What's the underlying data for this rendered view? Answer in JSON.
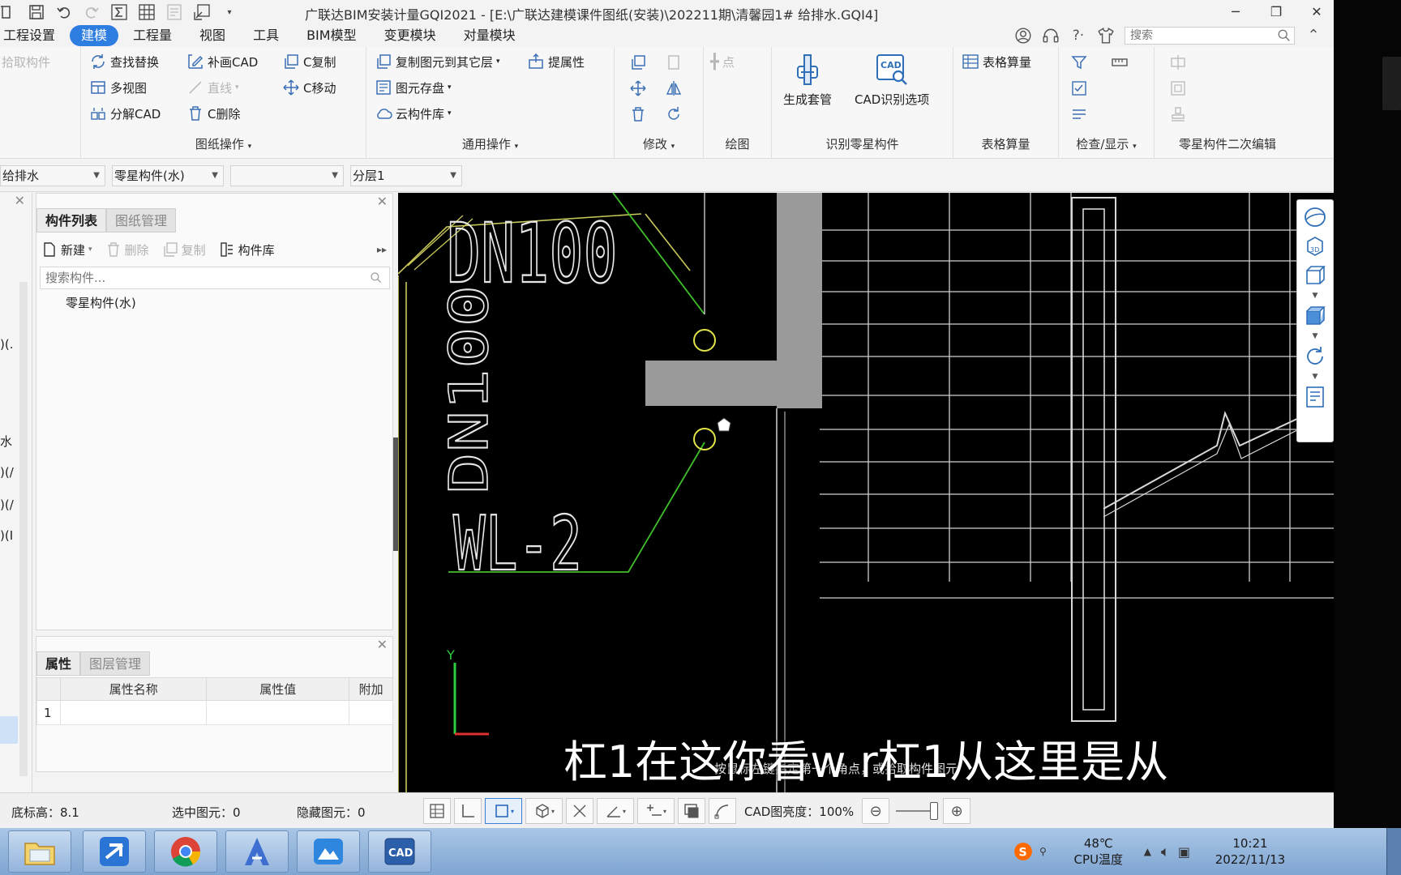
{
  "window": {
    "title": "广联达BIM安装计量GQI2021 - [E:\\广联达建模课件图纸(安装)\\202211期\\清馨园1# 给排水.GQI4]",
    "controls": [
      "minimize-icon",
      "restore-icon",
      "close-icon"
    ]
  },
  "menu": {
    "tabs": [
      {
        "label": "工程设置",
        "active": false
      },
      {
        "label": "建模",
        "active": true
      },
      {
        "label": "工程量",
        "active": false
      },
      {
        "label": "视图",
        "active": false
      },
      {
        "label": "工具",
        "active": false
      },
      {
        "label": "BIM模型",
        "active": false
      },
      {
        "label": "变更模块",
        "active": false
      },
      {
        "label": "对量模块",
        "active": false
      }
    ],
    "search_placeholder": "搜索"
  },
  "ribbon": {
    "pick_component": "拾取构件",
    "drawing_ops": {
      "label": "图纸操作",
      "items": [
        "查找替换",
        "补画CAD",
        "C复制",
        "多视图",
        "直线",
        "C移动",
        "分解CAD",
        "C删除"
      ]
    },
    "common_ops": {
      "label": "通用操作",
      "items": [
        "复制图元到其它层",
        "提属性",
        "图元存盘",
        "云构件库"
      ]
    },
    "modify": {
      "label": "修改"
    },
    "draw": {
      "label": "绘图",
      "point": "点"
    },
    "identify": {
      "label": "识别零星构件",
      "generate_sleeve": "生成套管",
      "cad_options": "CAD识别选项"
    },
    "table_calc": {
      "label": "表格算量",
      "button": "表格算量"
    },
    "check_display": {
      "label": "检查/显示"
    },
    "secondary_edit": {
      "label": "零星构件二次编辑"
    }
  },
  "layerbar": {
    "discipline": "给排水",
    "component_type": "零星构件(水)",
    "empty_combo": "",
    "floor": "分层1"
  },
  "left_strip": {
    "fragments": [
      ")(.",
      "水",
      ")(/",
      ")(/",
      ")(I"
    ]
  },
  "component_panel": {
    "tabs": [
      {
        "label": "构件列表",
        "active": true
      },
      {
        "label": "图纸管理",
        "active": false
      }
    ],
    "toolbar": {
      "new": "新建",
      "delete": "删除",
      "copy": "复制",
      "library": "构件库"
    },
    "search_placeholder": "搜索构件...",
    "tree_item": "零星构件(水)"
  },
  "property_panel": {
    "tabs": [
      {
        "label": "属性",
        "active": true
      },
      {
        "label": "图层管理",
        "active": false
      }
    ],
    "columns": [
      "",
      "属性名称",
      "属性值",
      "附加"
    ],
    "rows": [
      {
        "index": "1",
        "name": "",
        "value": "",
        "extra": ""
      }
    ]
  },
  "canvas": {
    "labels": {
      "pipe_horizontal": "DN100",
      "pipe_vertical": "DN100",
      "riser": "WL-2",
      "axis_y": "Y"
    },
    "caption": "杠1在这你看w r杠1从这里是从",
    "hint": "按鼠标左键指定第一个角点，或拾取构件图元"
  },
  "statusbar": {
    "floor_height": "底标高：8.1",
    "selected": "选中图元：0",
    "hidden": "隐藏图元：0",
    "cad_brightness": "CAD图亮度：100%"
  },
  "taskbar": {
    "apps": [
      "file-explorer-icon",
      "glodon-app-icon",
      "chrome-icon",
      "autocad-icon",
      "cloud-app-icon",
      "cad-viewer-icon"
    ],
    "temperature": "48℃",
    "temperature_label": "CPU温度",
    "time": "10:21",
    "date": "2022/11/13"
  },
  "colors": {
    "accent": "#2e7de1",
    "cad_green": "#3fbf2a",
    "cad_yellow": "#c8c85a",
    "wall_gray": "#9a9a9a"
  }
}
